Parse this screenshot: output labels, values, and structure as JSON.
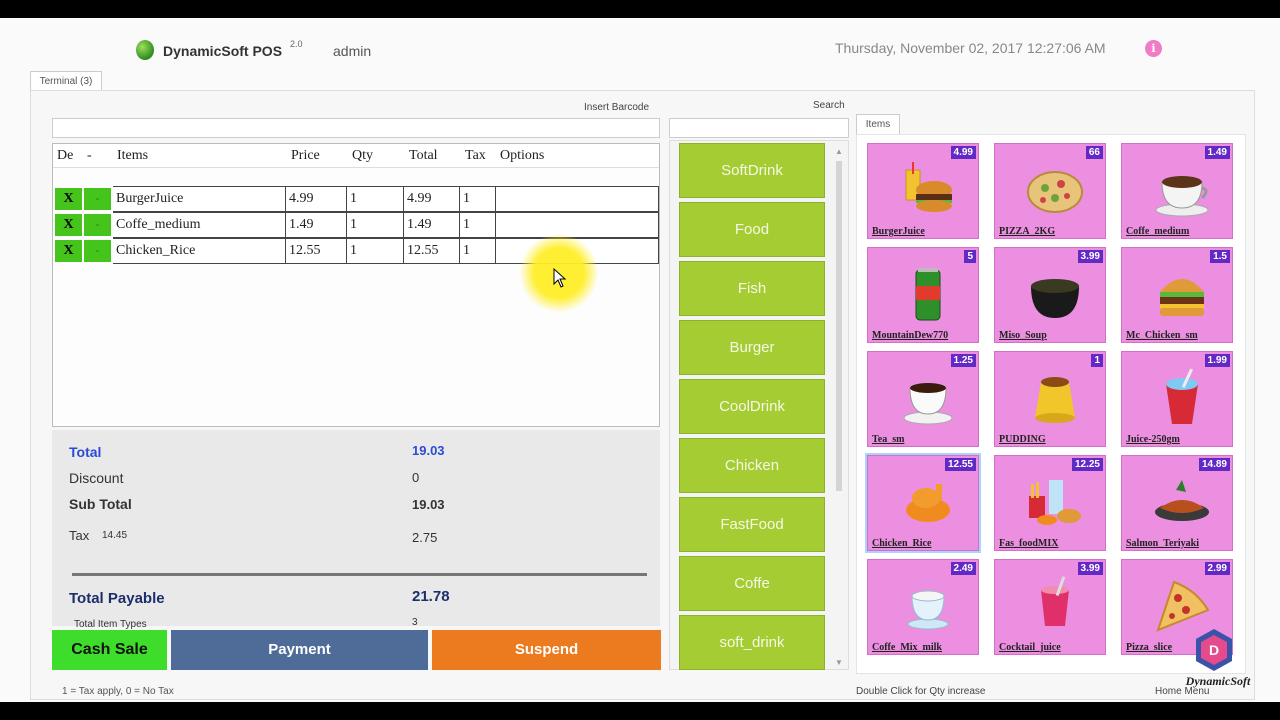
{
  "header": {
    "app_title": "DynamicSoft POS",
    "version": "2.0",
    "user": "admin",
    "datetime": "Thursday,  November 02,  2017  12:27:06  AM",
    "info_glyph": "i"
  },
  "terminal_tab": "Terminal (3)",
  "barcode_label": "Insert Barcode",
  "search_label": "Search",
  "grid": {
    "headers": [
      "De",
      "-",
      "Items",
      "Price",
      "Qty",
      "Total",
      "Tax",
      "Options"
    ],
    "rows": [
      {
        "del": "X",
        "minus": "-",
        "item": "BurgerJuice",
        "price": "4.99",
        "qty": "1",
        "total": "4.99",
        "tax": "1"
      },
      {
        "del": "X",
        "minus": "-",
        "item": "Coffe_medium",
        "price": "1.49",
        "qty": "1",
        "total": "1.49",
        "tax": "1"
      },
      {
        "del": "X",
        "minus": "-",
        "item": "Chicken_Rice",
        "price": "12.55",
        "qty": "1",
        "total": "12.55",
        "tax": "1"
      }
    ]
  },
  "totals": {
    "total_label": "Total",
    "total_value": "19.03",
    "discount_label": "Discount",
    "discount_value": "0",
    "subtotal_label": "Sub Total",
    "subtotal_value": "19.03",
    "tax_label": "Tax",
    "tax_rate": "14.45",
    "tax_value": "2.75",
    "payable_label": "Total Payable",
    "payable_value": "21.78",
    "item_types_label": "Total Item Types",
    "item_types_value": "3"
  },
  "buttons": {
    "cash_sale": "Cash Sale",
    "payment": "Payment",
    "suspend": "Suspend"
  },
  "legend": "1 = Tax apply, 0 = No Tax",
  "categories": [
    "SoftDrink",
    "Food",
    "Fish",
    "Burger",
    "CoolDrink",
    "Chicken",
    "FastFood",
    "Coffe",
    "soft_drink"
  ],
  "items_tab": "Items",
  "items": [
    {
      "name": "BurgerJuice",
      "price": "4.99",
      "icon": "burger-juice-icon"
    },
    {
      "name": "PIZZA_2KG",
      "price": "66",
      "icon": "pizza-icon"
    },
    {
      "name": "Coffe_medium",
      "price": "1.49",
      "icon": "coffee-cup-icon"
    },
    {
      "name": "MountainDew770",
      "price": "5",
      "icon": "soda-can-icon"
    },
    {
      "name": "Miso_Soup",
      "price": "3.99",
      "icon": "soup-bowl-icon"
    },
    {
      "name": "Mc_Chicken_sm",
      "price": "1.5",
      "icon": "burger-icon"
    },
    {
      "name": "Tea_sm",
      "price": "1.25",
      "icon": "tea-cup-icon"
    },
    {
      "name": "PUDDING",
      "price": "1",
      "icon": "pudding-icon"
    },
    {
      "name": "Juice-250gm",
      "price": "1.99",
      "icon": "juice-cup-icon"
    },
    {
      "name": "Chicken_Rice",
      "price": "12.55",
      "icon": "chicken-icon"
    },
    {
      "name": "Fas_foodMIX",
      "price": "12.25",
      "icon": "fastfood-icon"
    },
    {
      "name": "Salmon_Teriyaki",
      "price": "14.89",
      "icon": "salmon-icon"
    },
    {
      "name": "Coffe_Mix_milk",
      "price": "2.49",
      "icon": "milk-coffee-icon"
    },
    {
      "name": "Cocktail_juice",
      "price": "3.99",
      "icon": "cocktail-icon"
    },
    {
      "name": "Pizza_slice",
      "price": "2.99",
      "icon": "pizza-slice-icon"
    }
  ],
  "status": {
    "double_click_hint": "Double Click for Qty increase",
    "home_menu": "Home Menu"
  },
  "brand": {
    "name": "DynamicSoft",
    "letter": "D"
  },
  "colors": {
    "category_green": "#a6cc34",
    "item_pink": "#ec8fe0",
    "price_badge": "#6329c4",
    "cash_green": "#3edc2b",
    "payment_blue": "#4f6c99",
    "suspend_orange": "#ec7a1f"
  }
}
